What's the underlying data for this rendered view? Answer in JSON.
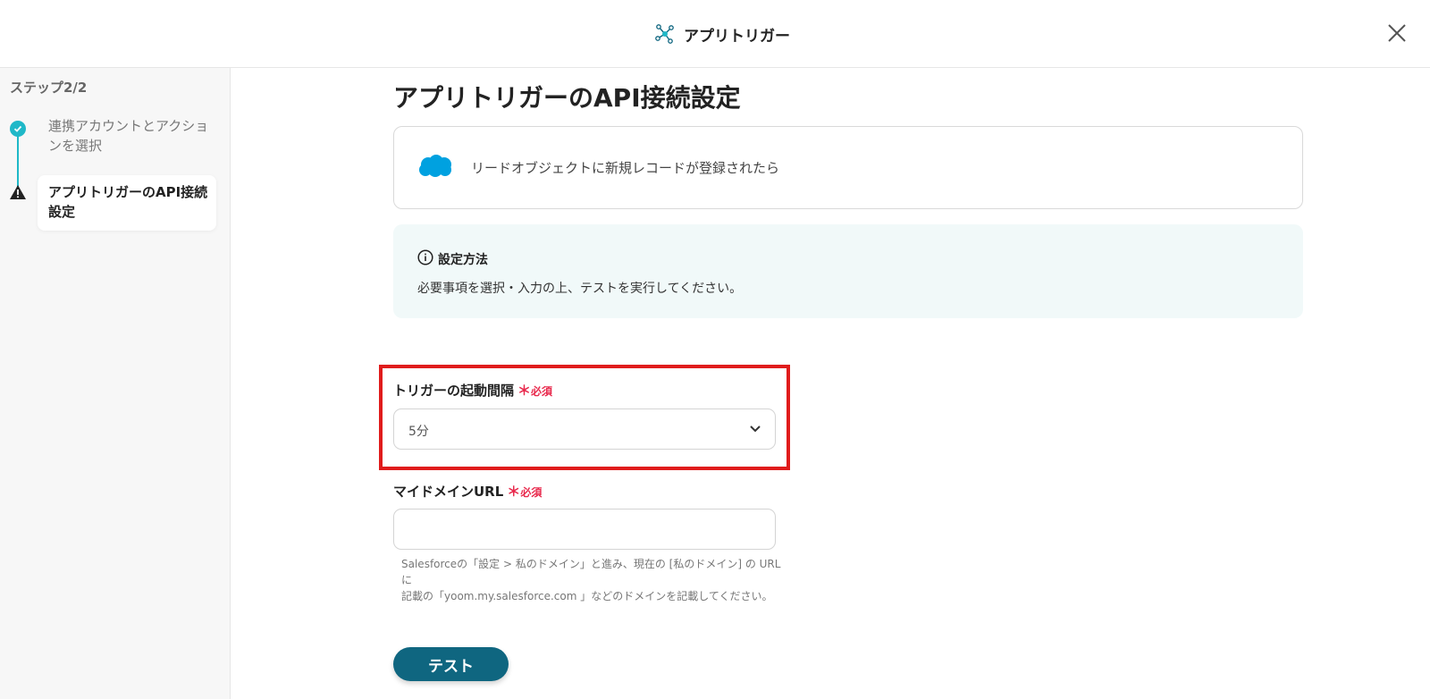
{
  "header": {
    "title": "アプリトリガー"
  },
  "sidebar": {
    "step_label": "ステップ2/2",
    "steps": [
      {
        "label": "連携アカウントとアクションを選択",
        "status": "complete"
      },
      {
        "label": "アプリトリガーのAPI接続設定",
        "status": "warning"
      }
    ]
  },
  "main": {
    "title": "アプリトリガーのAPI接続設定",
    "app_card": {
      "app_icon": "salesforce-cloud-icon",
      "event": "リードオブジェクトに新規レコードが登録されたら"
    },
    "info": {
      "title": "設定方法",
      "text": "必要事項を選択・入力の上、テストを実行してください。"
    },
    "fields": {
      "interval": {
        "label": "トリガーの起動間隔",
        "required_mark": "＊",
        "required_text": "必須",
        "value": "5分"
      },
      "domain_url": {
        "label": "マイドメインURL",
        "required_mark": "＊",
        "required_text": "必須",
        "value": "",
        "help_line1": "Salesforceの「設定 > 私のドメイン」と進み、現在の [私のドメイン] の URLに",
        "help_line2": "記載の「yoom.my.salesforce.com 」などのドメインを記載してください。"
      }
    },
    "test_button": "テスト"
  },
  "colors": {
    "accent": "#1fb8c8",
    "button": "#0f6680",
    "required": "#e8294c",
    "highlight": "#e01c1c",
    "info_bg": "#f1f9f9"
  }
}
